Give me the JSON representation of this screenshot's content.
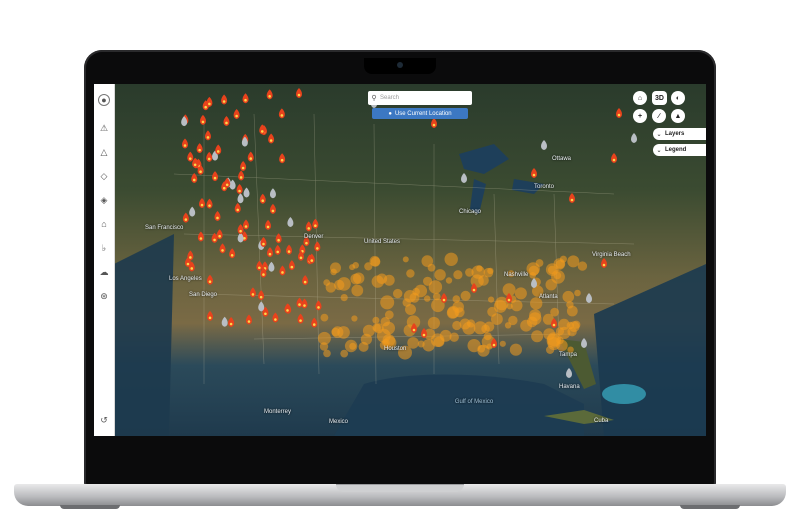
{
  "search": {
    "placeholder": "Search"
  },
  "location_button": {
    "label": "Use Current Location"
  },
  "controls": {
    "three_d_label": "3D",
    "zoom_in": "+",
    "zoom_out": "-",
    "layers_label": "Layers",
    "legend_label": "Legend",
    "add_label": "+"
  },
  "map_labels": {
    "country": "United States",
    "country_south": "Mexico",
    "cuba": "Cuba",
    "gulf": "Gulf of Mexico",
    "cities": [
      {
        "name": "Ottawa"
      },
      {
        "name": "Chicago"
      },
      {
        "name": "Toronto"
      },
      {
        "name": "San Francisco"
      },
      {
        "name": "Los Angeles"
      },
      {
        "name": "Houston"
      },
      {
        "name": "Havana"
      },
      {
        "name": "Tampa"
      },
      {
        "name": "Atlanta"
      },
      {
        "name": "Virginia Beach"
      },
      {
        "name": "Monterrey"
      },
      {
        "name": "Nashville"
      },
      {
        "name": "Denver"
      },
      {
        "name": "San Diego"
      }
    ]
  },
  "colors": {
    "accent": "#3c78c3",
    "fire": "#e8421c",
    "fire_core": "#ffd54a",
    "hotspot": "#f39a1e",
    "smoke": "#b9bec4"
  },
  "icons": {
    "rail": [
      "user-icon",
      "warning-icon",
      "flame-icon",
      "tag-icon",
      "diamond-alert-icon",
      "station-icon",
      "bell-icon",
      "cloud-icon",
      "antenna-icon",
      "logout-icon"
    ]
  }
}
